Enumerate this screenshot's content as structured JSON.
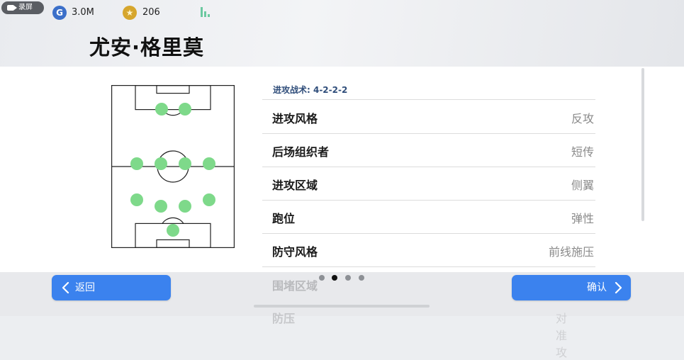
{
  "status_bar": {
    "record_label": "录屏",
    "gp_value": "3.0M",
    "coins_value": "206"
  },
  "page": {
    "title": "尤安·格里莫"
  },
  "tactic": {
    "label": "进攻战术: 4-2-2-2",
    "formation": "4-2-2-2"
  },
  "settings": [
    {
      "key": "进攻风格",
      "value": "反攻"
    },
    {
      "key": "后场组织者",
      "value": "短传"
    },
    {
      "key": "进攻区域",
      "value": "侧翼"
    },
    {
      "key": "跑位",
      "value": "弹性"
    },
    {
      "key": "防守风格",
      "value": "前线施压"
    }
  ],
  "partial_rows": [
    {
      "key": "围堵区域"
    },
    {
      "key": "防压",
      "value": "对准攻"
    }
  ],
  "pagination": {
    "total": 4,
    "active": 1
  },
  "buttons": {
    "back": "返回",
    "confirm": "确认"
  },
  "icons": {
    "record": "video-camera-icon",
    "gp": "g-coin-icon",
    "coins": "star-coin-icon",
    "signal": "signal-bars-icon",
    "back": "chevron-left-icon",
    "confirm": "chevron-right-icon"
  },
  "colors": {
    "accent": "#3b82ee",
    "player_dot": "#7ed98a",
    "tactic_label": "#2f4d7a",
    "value_text": "#8a8a8a"
  }
}
